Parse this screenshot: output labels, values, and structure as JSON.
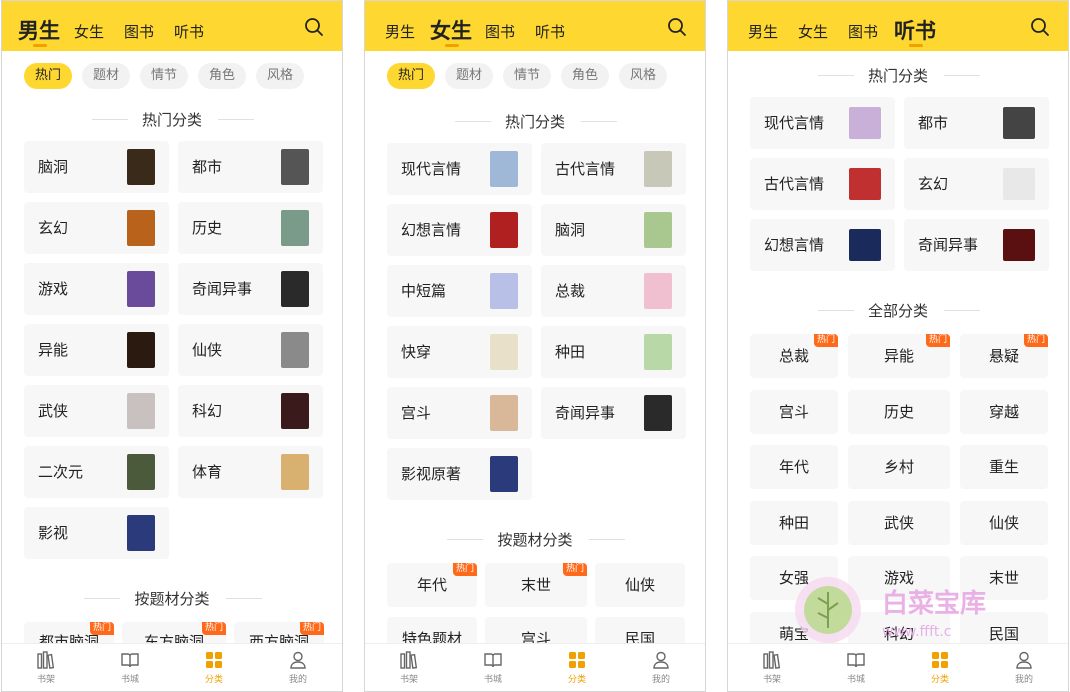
{
  "tabs": [
    "男生",
    "女生",
    "图书",
    "听书"
  ],
  "chips": [
    "热门",
    "题材",
    "情节",
    "角色",
    "风格"
  ],
  "sections": {
    "hot": "热门分类",
    "by_topic": "按题材分类",
    "all": "全部分类"
  },
  "hot_badge": "热门",
  "nav": [
    "书架",
    "书城",
    "分类",
    "我的"
  ],
  "male": {
    "hot": [
      "脑洞",
      "都市",
      "玄幻",
      "历史",
      "游戏",
      "奇闻异事",
      "异能",
      "仙侠",
      "武侠",
      "科幻",
      "二次元",
      "体育",
      "影视"
    ],
    "topic_partial": [
      "都市脑洞",
      "东方脑洞",
      "西方脑洞"
    ]
  },
  "female": {
    "hot": [
      "现代言情",
      "古代言情",
      "幻想言情",
      "脑洞",
      "中短篇",
      "总裁",
      "快穿",
      "种田",
      "宫斗",
      "奇闻异事",
      "影视原著"
    ],
    "topic": [
      "年代",
      "末世",
      "仙侠"
    ],
    "topic_partial": [
      "特色题材",
      "宫斗",
      "民国"
    ]
  },
  "audio": {
    "hot": [
      "现代言情",
      "都市",
      "古代言情",
      "玄幻",
      "幻想言情",
      "奇闻异事"
    ],
    "all": [
      "总裁",
      "异能",
      "悬疑",
      "宫斗",
      "历史",
      "穿越",
      "年代",
      "乡村",
      "重生",
      "种田",
      "武侠",
      "仙侠",
      "女强",
      "游戏",
      "末世",
      "萌宝",
      "科幻",
      "民国"
    ]
  },
  "watermark": {
    "title": "白菜宝库",
    "url": "www.ffft.c"
  },
  "colors": {
    "accent": "#fed831",
    "badge": "#ff6a1a",
    "nav_active": "#f0a000"
  }
}
